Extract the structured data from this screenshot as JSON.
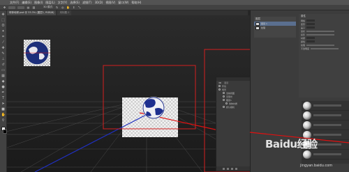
{
  "menu": [
    "文件(F)",
    "编辑(E)",
    "图像(I)",
    "图层(L)",
    "文字(Y)",
    "选择(S)",
    "滤镜(T)",
    "3D(D)",
    "视图(V)",
    "窗口(W)",
    "帮助(H)"
  ],
  "options": {
    "mode_label": "3D 模式:"
  },
  "tabs": [
    {
      "label": "球体地球.psd @ 33.3% (图层1, RGB/8)",
      "active": true
    },
    {
      "label": "未标题-1",
      "active": false
    }
  ],
  "floating_panel": {
    "tabs": [
      "3D",
      "图层"
    ],
    "rows": [
      {
        "label": "环境",
        "level": 0
      },
      {
        "label": "场景",
        "level": 0
      },
      {
        "label": "当前视图",
        "level": 1
      },
      {
        "label": "无限光",
        "level": 1
      },
      {
        "label": "图层1",
        "level": 1
      },
      {
        "label": "球体材质",
        "level": 2
      },
      {
        "label": "默认相机",
        "level": 1
      }
    ]
  },
  "layers_panel": {
    "title": "图层",
    "rows": [
      {
        "label": "图层 1",
        "selected": true
      },
      {
        "label": "纹理",
        "selected": false
      }
    ]
  },
  "properties": {
    "title": "属性",
    "rows": [
      "网格",
      "变形",
      "盖子",
      "坐标",
      "投影",
      "材质",
      "颜色",
      "纹理",
      "不透明度"
    ]
  },
  "watermark": {
    "text": "Baidu经验",
    "url": "jingyan.baidu.com"
  },
  "colors": {
    "highlight": "#d31f1f",
    "axis_red": "#e01010",
    "axis_blue": "#2030c0"
  }
}
